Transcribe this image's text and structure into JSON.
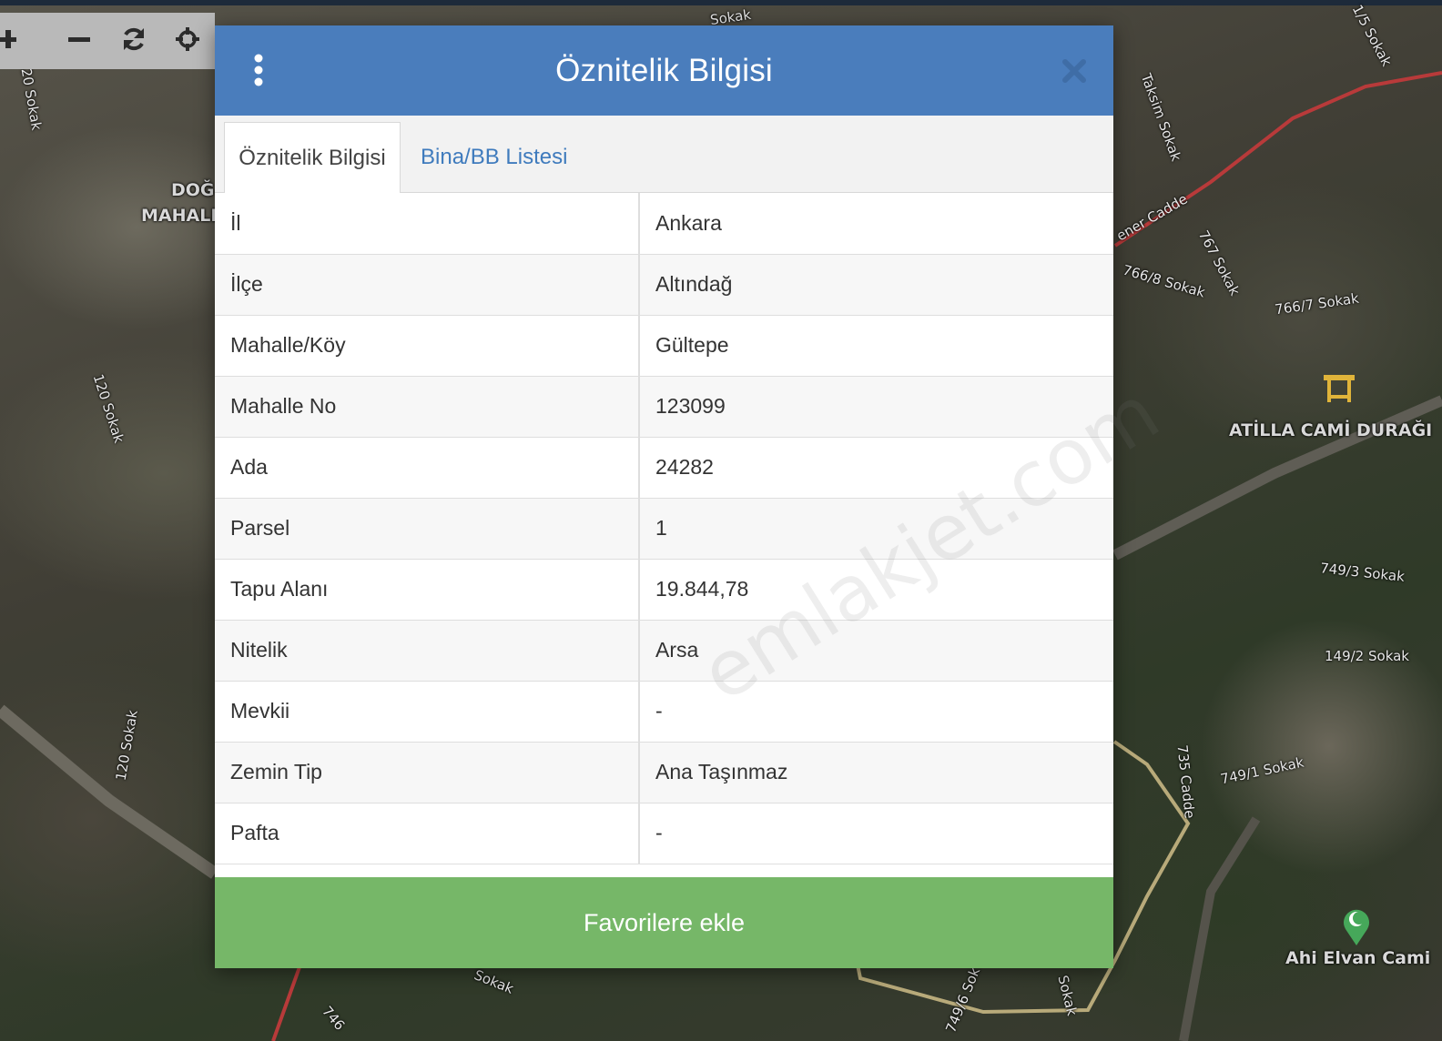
{
  "map": {
    "labels": {
      "sokak_top": "Sokak",
      "sokak_top2": "1/5 Sokak",
      "sokak_120_a": "20 Sokak",
      "sokak_120_b": "120 Sokak",
      "sokak_120_c": "120 Sokak",
      "dog": "DOĞ",
      "mahal": "MAHALL",
      "taksim": "Taksim Sokak",
      "cadde": "ener Cadde",
      "s767": "767 Sokak",
      "s7668": "766/8 Sokak",
      "s7667": "766/7 Sokak",
      "stop": "ATİLLA CAMİ DURAĞI",
      "s7493": "749/3 Sokak",
      "s1492": "149/2 Sokak",
      "s7491": "749/1 Sokak",
      "c735": "735 Cadde",
      "mosque": "Ahi Elvan Cami",
      "sokak_bottom": "Sokak",
      "s746": "746",
      "s7496": "749/6 Sok",
      "sokak_right_bottom": "Sokak"
    },
    "icons": [
      "bus-stop-icon",
      "mosque-icon"
    ]
  },
  "toolbar": {
    "buttons": [
      "zoom-in",
      "zoom-out",
      "refresh",
      "locate"
    ]
  },
  "modal": {
    "title": "Öznitelik Bilgisi",
    "tabs": [
      {
        "label": "Öznitelik Bilgisi",
        "active": true
      },
      {
        "label": "Bina/BB Listesi",
        "active": false
      }
    ],
    "rows": [
      {
        "key": "İl",
        "value": "Ankara"
      },
      {
        "key": "İlçe",
        "value": "Altındağ"
      },
      {
        "key": "Mahalle/Köy",
        "value": "Gültepe"
      },
      {
        "key": "Mahalle No",
        "value": "123099"
      },
      {
        "key": "Ada",
        "value": "24282"
      },
      {
        "key": "Parsel",
        "value": "1"
      },
      {
        "key": "Tapu Alanı",
        "value": "19.844,78"
      },
      {
        "key": "Nitelik",
        "value": "Arsa"
      },
      {
        "key": "Mevkii",
        "value": "-"
      },
      {
        "key": "Zemin Tip",
        "value": "Ana Taşınmaz"
      },
      {
        "key": "Pafta",
        "value": "-"
      }
    ],
    "favorite_button": "Favorilere ekle",
    "watermark": "emlakjet.com"
  },
  "colors": {
    "header_blue": "#4a7dbc",
    "tab_link_blue": "#3f7bbd",
    "button_green": "#76b768"
  }
}
